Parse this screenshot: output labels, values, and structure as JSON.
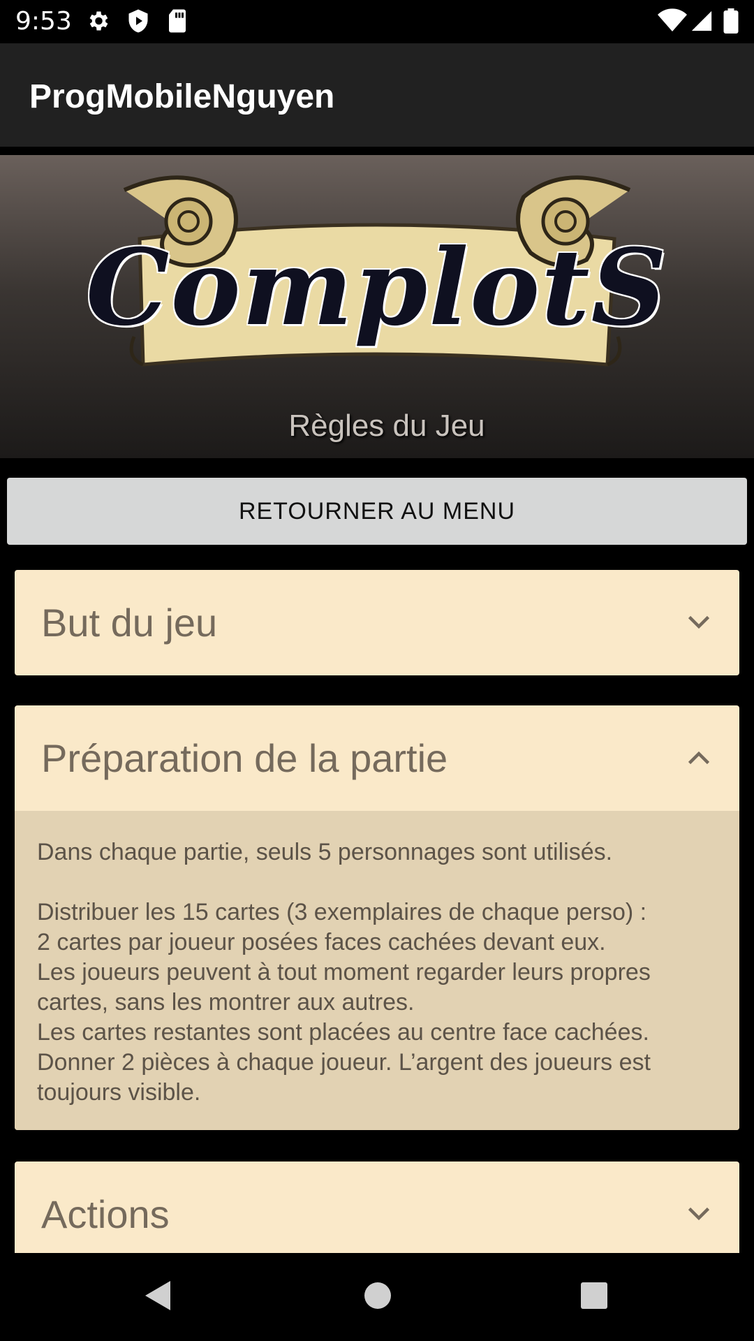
{
  "status_bar": {
    "time": "9:53",
    "left_icons": [
      "settings-icon",
      "play-protect-icon",
      "sd-card-icon"
    ],
    "right_icons": [
      "wifi-icon",
      "cell-signal-icon",
      "battery-icon"
    ]
  },
  "app_bar": {
    "title": "ProgMobileNguyen"
  },
  "banner": {
    "logo_text": "ComplotS",
    "subtitle": "Règles du Jeu"
  },
  "menu_button": {
    "label": "RETOURNER AU MENU"
  },
  "sections": [
    {
      "title": "But du jeu",
      "expanded": false,
      "icon": "chevron-down-icon"
    },
    {
      "title": "Préparation de la partie",
      "expanded": true,
      "icon": "chevron-up-icon",
      "content": "Dans chaque partie, seuls 5 personnages sont utilisés.\n\nDistribuer les 15 cartes (3 exemplaires de chaque perso) :\n2 cartes par joueur posées faces cachées devant eux.\nLes joueurs peuvent à tout moment regarder leurs propres cartes, sans les montrer aux autres.\nLes cartes restantes sont placées au centre face cachées.\nDonner 2 pièces à chaque joueur. L’argent des joueurs est toujours visible."
    },
    {
      "title": "Actions",
      "expanded": false,
      "icon": "chevron-down-icon"
    }
  ],
  "nav_bar": {
    "buttons": [
      "back-icon",
      "home-icon",
      "recents-icon"
    ]
  },
  "colors": {
    "card_header": "#fae9c9",
    "card_body": "#e2d2b3",
    "header_text": "#756a5c",
    "app_bar": "#212121"
  }
}
